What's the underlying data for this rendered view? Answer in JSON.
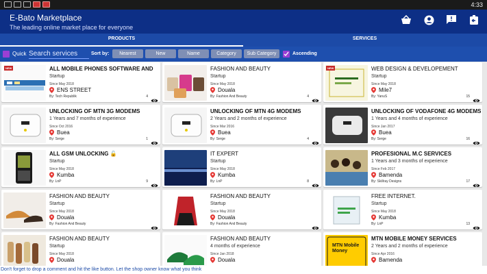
{
  "status_bar": {
    "time": "4:33"
  },
  "app": {
    "title": "E-Bato Marketplace",
    "subtitle": "The leading online market place for everyone",
    "accent": "#0d2f86"
  },
  "tabs": [
    {
      "label": "PRODUCTS",
      "active": true
    },
    {
      "label": "SERVICES",
      "active": false
    }
  ],
  "filter": {
    "quick_label": "Quick",
    "search_placeholder": "Search services",
    "sort_by_label": "Sort by:",
    "sort_buttons": [
      "Nearest",
      "New",
      "Name",
      "Category",
      "Sub Category"
    ],
    "ascending_label": "Ascending"
  },
  "cards": [
    {
      "title": "ALL MOBILE PHONES SOFTWARE AND",
      "status": "Startup",
      "since": "Since May 2018",
      "location": "ENS STREET",
      "by": "By: Tech Republik",
      "count": "4",
      "thumb": "phones",
      "new": true,
      "bold": true
    },
    {
      "title": "FASHION AND BEAUTY",
      "status": "Startup",
      "since": "Since May 2018",
      "location": "Douala",
      "by": "By: Fashion And Beauty",
      "count": "4",
      "thumb": "bags",
      "new": false,
      "bold": false
    },
    {
      "title": "WEB DESIGN & DEVELOPEMENT",
      "status": "Startup",
      "since": "Since May 2018",
      "location": "Mile7",
      "by": "By: YanuS",
      "count": "15",
      "thumb": "web",
      "new": true,
      "bold": false
    },
    {
      "title": "UNLOCKING OF MTN 3G MODEMS",
      "status": "1 Years and 7 months of experience",
      "since": "Since Oct 2016",
      "location": "Buea",
      "by": "By: Serge",
      "count": "1",
      "thumb": "modem",
      "new": false,
      "bold": true
    },
    {
      "title": "UNLOCKING OF MTN 4G MODEMS",
      "status": "2 Years and 2 months of experience",
      "since": "Since Mar 2016",
      "location": "Buea",
      "by": "By: Serge",
      "count": "4",
      "thumb": "modem",
      "new": false,
      "bold": true
    },
    {
      "title": "UNLOCKING OF VODAFONE 4G MODEMS",
      "status": "1 Years and 4 months of experience",
      "since": "Since Jan 2017",
      "location": "Buea",
      "by": "By: Serge",
      "count": "16",
      "thumb": "modemdark",
      "new": false,
      "bold": true
    },
    {
      "title": "ALL GSM  UNLOCKING 🔓",
      "status": "Startup",
      "since": "Since May 2018",
      "location": "Kumba",
      "by": "By: LnP",
      "count": "9",
      "thumb": "phone",
      "new": false,
      "bold": true
    },
    {
      "title": "IT EXPERT",
      "status": "Startup",
      "since": "Since May 2018",
      "location": "Kumba",
      "by": "By: LnP",
      "count": "8",
      "thumb": "sunset",
      "new": false,
      "bold": false
    },
    {
      "title": "PROFESIONAL M.C  SERVICES",
      "status": "1 Years and 3 months of experience",
      "since": "Since Feb 2017",
      "location": "Bamenda",
      "by": "By: Skillray Designs",
      "count": "17",
      "thumb": "crowd",
      "new": false,
      "bold": true
    },
    {
      "title": "FASHION AND BEAUTY",
      "status": "Startup",
      "since": "Since May 2018",
      "location": "Douala",
      "by": "By: Fashion And Beauty",
      "count": "",
      "thumb": "shoes",
      "new": false,
      "bold": false
    },
    {
      "title": "FASHION AND BEAUTY",
      "status": "Startup",
      "since": "Since May 2018",
      "location": "Douala",
      "by": "By: Fashion And Beauty",
      "count": "",
      "thumb": "dress",
      "new": false,
      "bold": false
    },
    {
      "title": "FREE INTERNET.",
      "status": "Startup",
      "since": "Since May 2018",
      "location": "Kumba",
      "by": "By: LnP",
      "count": "13",
      "thumb": "screen",
      "new": false,
      "bold": false
    },
    {
      "title": "FASHION AND BEAUTY",
      "status": "Startup",
      "since": "Since May 2018",
      "location": "Douala",
      "by": "",
      "count": "",
      "thumb": "sandals",
      "new": false,
      "bold": false
    },
    {
      "title": "FASHION AND BEAUTY",
      "status": "4 months of experience",
      "since": "Since Jan 2018",
      "location": "Douala",
      "by": "",
      "count": "",
      "thumb": "greenshoes",
      "new": false,
      "bold": false
    },
    {
      "title": "MTN MOBILE MONEY SERVICES",
      "status": "2 Years and 2 months of experience",
      "since": "Since Apr 2016",
      "location": "Bamenda",
      "by": "",
      "count": "",
      "thumb": "mtn",
      "new": false,
      "bold": true
    }
  ],
  "new_badge": "NEW",
  "mtn_text": "MTN Mobile Money",
  "footer_text": "Don't forget to drop a comment and hit the like button. Let the shop owner know what you think"
}
